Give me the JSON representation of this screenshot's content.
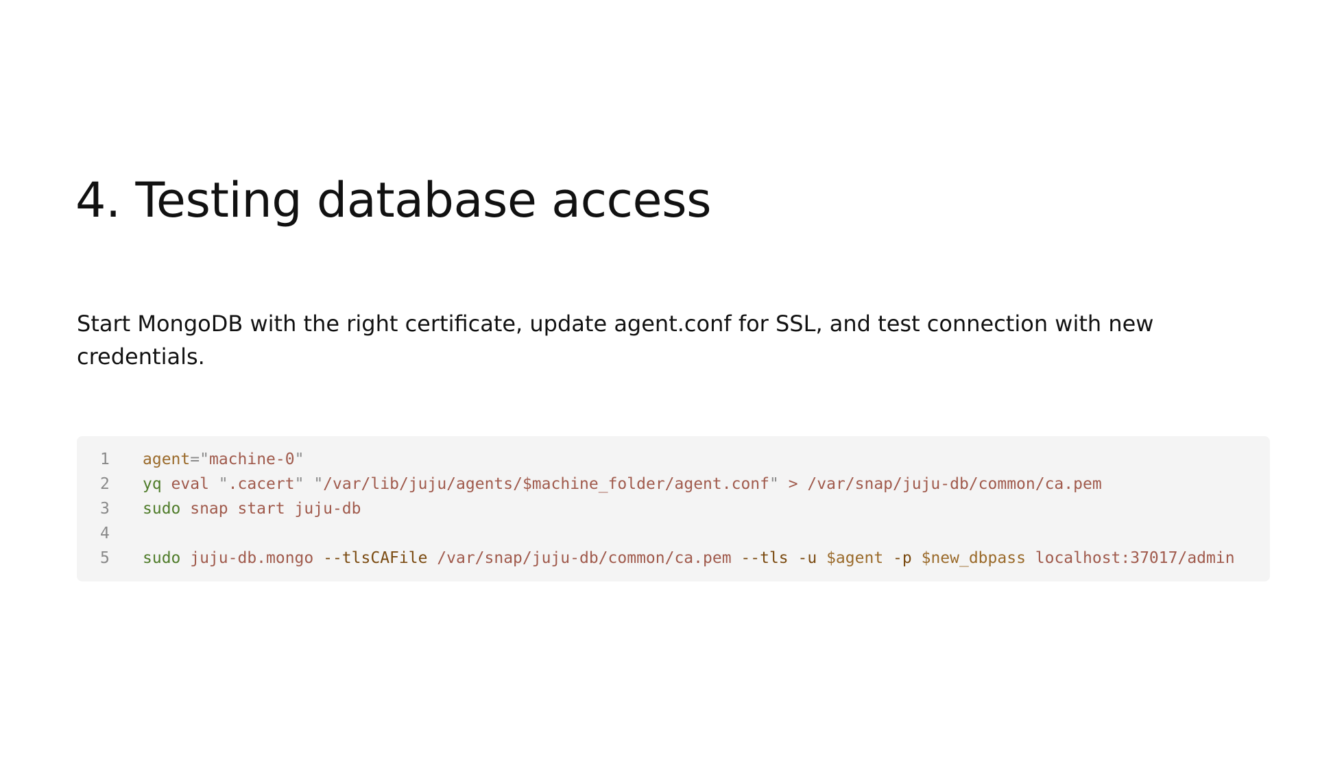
{
  "slide": {
    "title": "4. Testing database access",
    "description": "Start MongoDB with the right certificate, update agent.conf for SSL, and test connection with new credentials."
  },
  "code": {
    "lines": [
      {
        "number": "1",
        "tokens": [
          {
            "t": "agent",
            "c": "vr"
          },
          {
            "t": "=",
            "c": "op"
          },
          {
            "t": "\"",
            "c": "op"
          },
          {
            "t": "machine-0",
            "c": "tx"
          },
          {
            "t": "\"",
            "c": "op"
          }
        ]
      },
      {
        "number": "2",
        "tokens": [
          {
            "t": "yq",
            "c": "kw"
          },
          {
            "t": " eval ",
            "c": "tx"
          },
          {
            "t": "\"",
            "c": "op"
          },
          {
            "t": ".cacert",
            "c": "tx"
          },
          {
            "t": "\"",
            "c": "op"
          },
          {
            "t": " ",
            "c": "tx"
          },
          {
            "t": "\"",
            "c": "op"
          },
          {
            "t": "/var/lib/juju/agents/$machine_folder/agent.conf",
            "c": "tx"
          },
          {
            "t": "\"",
            "c": "op"
          },
          {
            "t": " > ",
            "c": "tx"
          },
          {
            "t": "/var/snap/juju-db/common/ca.pem",
            "c": "tx"
          }
        ]
      },
      {
        "number": "3",
        "tokens": [
          {
            "t": "sudo",
            "c": "kw"
          },
          {
            "t": " snap start juju-db",
            "c": "tx"
          }
        ]
      },
      {
        "number": "4",
        "tokens": []
      },
      {
        "number": "5",
        "tokens": [
          {
            "t": "sudo",
            "c": "kw"
          },
          {
            "t": " juju-db.mongo ",
            "c": "tx"
          },
          {
            "t": "--tlsCAFile",
            "c": "fl"
          },
          {
            "t": " /var/snap/juju-db/common/ca.pem ",
            "c": "tx"
          },
          {
            "t": "--tls",
            "c": "fl"
          },
          {
            "t": " ",
            "c": "tx"
          },
          {
            "t": "-u",
            "c": "fl"
          },
          {
            "t": " ",
            "c": "tx"
          },
          {
            "t": "$agent",
            "c": "vr"
          },
          {
            "t": " ",
            "c": "tx"
          },
          {
            "t": "-p",
            "c": "fl"
          },
          {
            "t": " ",
            "c": "tx"
          },
          {
            "t": "$new_dbpass",
            "c": "vr"
          },
          {
            "t": " localhost:37017/admin",
            "c": "tx"
          }
        ]
      }
    ]
  }
}
